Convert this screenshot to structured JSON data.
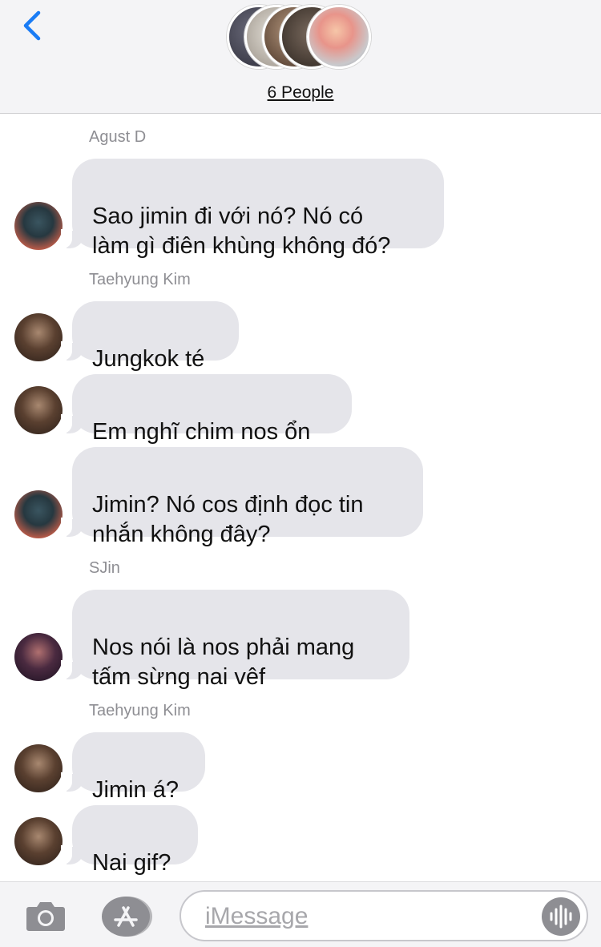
{
  "header": {
    "group_name": "6 People",
    "group_avatars": [
      "member-1",
      "member-2",
      "member-3",
      "member-4",
      "member-5"
    ]
  },
  "messages": [
    {
      "sender": "Agust D",
      "text": "Sao jimin đi với nó? Nó có\nlàm gì điên khùng không đó?",
      "avatar": "agust-d"
    },
    {
      "sender": "Taehyung Kim",
      "text": "Jungkok té",
      "avatar": "taehyung"
    },
    {
      "sender": "",
      "text": "Em nghĩ chim nos ổn",
      "avatar": "taehyung"
    },
    {
      "sender": "",
      "text": "Jimin? Nó cos định đọc tin\nnhắn không đây?",
      "avatar": "agust-d"
    },
    {
      "sender": "SJin",
      "text": "Nos nói là nos phải mang\ntấm sừng nai vêf",
      "avatar": "sjin"
    },
    {
      "sender": "Taehyung Kim",
      "text": "Jimin á?",
      "avatar": "taehyung"
    },
    {
      "sender": "",
      "text": "Nai gif?",
      "avatar": "taehyung"
    }
  ],
  "composer": {
    "placeholder": "iMessage"
  },
  "icons": {
    "back": "chevron-left-icon",
    "camera": "camera-icon",
    "apps": "app-store-icon",
    "audio": "waveform-icon"
  },
  "colors": {
    "accent": "#1a7cf5",
    "bubble": "#e5e5ea",
    "sender_label": "#8e8e93"
  }
}
